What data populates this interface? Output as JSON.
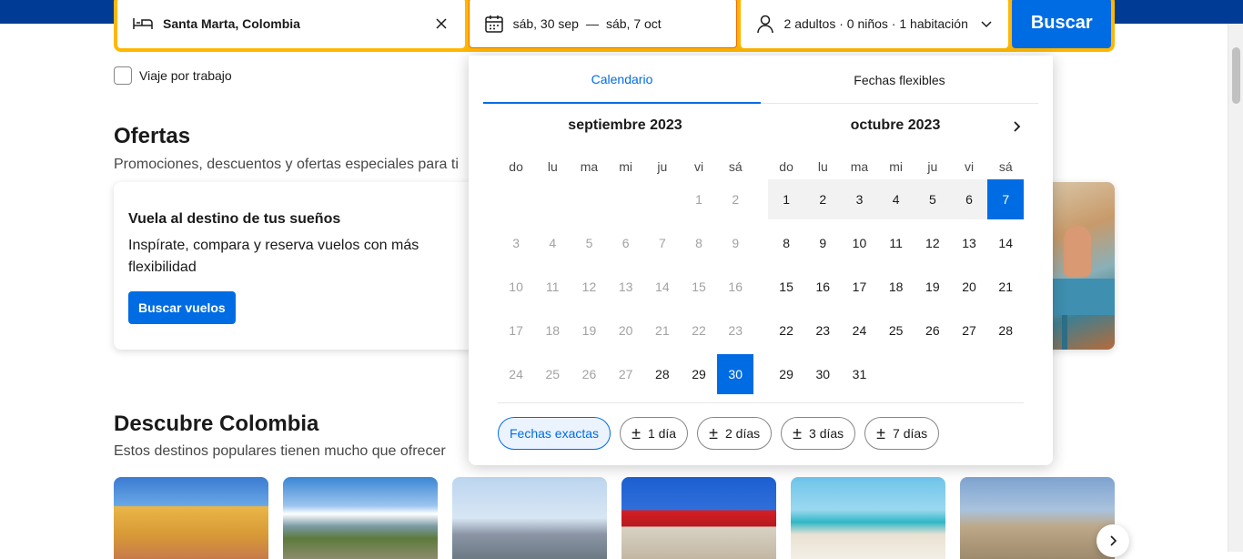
{
  "search": {
    "destination": "Santa Marta, Colombia",
    "check_in": "sáb, 30 sep",
    "dash": "—",
    "check_out": "sáb, 7 oct",
    "guests": "2 adultos · 0 niños · 1 habitación",
    "button": "Buscar"
  },
  "work_trip": {
    "label": "Viaje por trabajo",
    "checked": false
  },
  "offers": {
    "title": "Ofertas",
    "subtitle": "Promociones, descuentos y ofertas especiales para ti",
    "card": {
      "title": "Vuela al destino de tus sueños",
      "desc": "Inspírate, compara y reserva vuelos con más flexibilidad",
      "button": "Buscar vuelos"
    }
  },
  "discover": {
    "title": "Descubre Colombia",
    "subtitle": "Estos destinos populares tienen mucho que ofrecer"
  },
  "picker": {
    "tabs": [
      {
        "label": "Calendario",
        "active": true
      },
      {
        "label": "Fechas flexibles",
        "active": false
      }
    ],
    "weekdays": [
      "do",
      "lu",
      "ma",
      "mi",
      "ju",
      "vi",
      "sá"
    ],
    "months": [
      {
        "title": "septiembre 2023",
        "lead_blanks": 5,
        "days": 30,
        "past_until": 27,
        "selected": [
          30
        ],
        "range": []
      },
      {
        "title": "octubre 2023",
        "lead_blanks": 0,
        "days": 31,
        "past_until": 0,
        "selected": [
          7
        ],
        "range": [
          1,
          2,
          3,
          4,
          5,
          6
        ]
      }
    ],
    "chips": [
      {
        "label": "Fechas exactas",
        "active": true,
        "plus_minus": false
      },
      {
        "label": "1 día",
        "active": false,
        "plus_minus": true
      },
      {
        "label": "2 días",
        "active": false,
        "plus_minus": true
      },
      {
        "label": "3 días",
        "active": false,
        "plus_minus": true
      },
      {
        "label": "7 días",
        "active": false,
        "plus_minus": true
      }
    ]
  },
  "colors": {
    "brand_blue": "#003b95",
    "action_blue": "#006ce4",
    "search_yellow": "#ffb700"
  }
}
